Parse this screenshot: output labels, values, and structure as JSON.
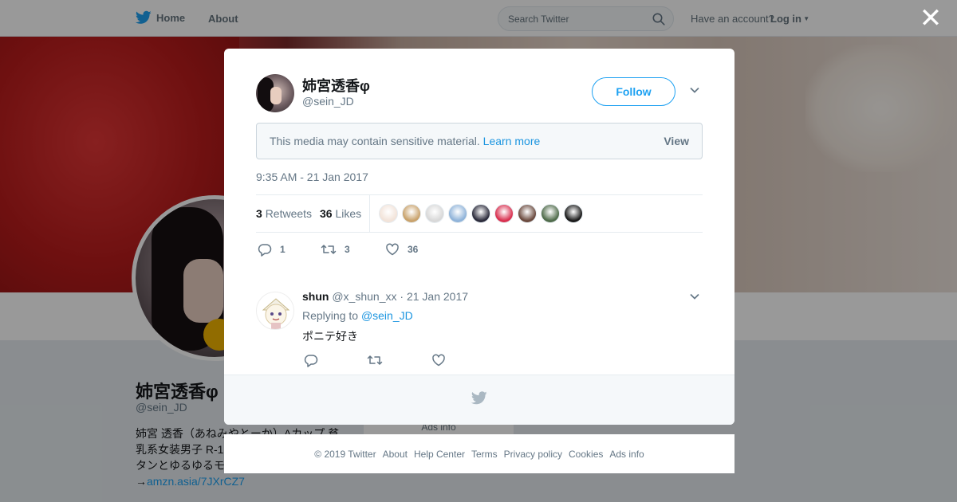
{
  "nav": {
    "home_label": "Home",
    "about_label": "About",
    "search_placeholder": "Search Twitter",
    "have_account": "Have an account?",
    "login_label": "Log in",
    "close_glyph": "✕"
  },
  "background_profile": {
    "name": "姉宮透香φ",
    "handle": "@sein_JD",
    "bio_line1": "姉宮 透香（あねみやとーか）Aカップ 貧",
    "bio_line2": "乳系女装男子 R-1",
    "bio_line3": "タンとゆるゆるモ",
    "bio_link_prefix": "→",
    "bio_link": "amzn.asia/7JXrCZ7",
    "ads_info": "Ads info"
  },
  "tweet": {
    "author_name": "姉宮透香φ",
    "author_handle": "@sein_JD",
    "follow_label": "Follow",
    "sensitive_text": "This media may contain sensitive material.",
    "learn_more": "Learn more",
    "view_label": "View",
    "timestamp": "9:35 AM - 21 Jan 2017",
    "retweet_count": "3",
    "retweet_label": "Retweets",
    "like_count": "36",
    "like_label": "Likes",
    "likers_colors": [
      "#f2e3d9",
      "#c9a26b",
      "#d8d8d8",
      "#8fb3d9",
      "#2b2b3b",
      "#d9304f",
      "#6b4a3e",
      "#4f6b4a",
      "#1a1a1a"
    ],
    "actions": {
      "replies": "1",
      "retweets": "3",
      "likes": "36"
    }
  },
  "reply": {
    "name": "shun",
    "handle": "@x_shun_xx",
    "separator": "·",
    "date": "21 Jan 2017",
    "replying_to_label": "Replying to",
    "replying_to_mention": "@sein_JD",
    "text": "ポニテ好き"
  },
  "footer": {
    "links": [
      "© 2019 Twitter",
      "About",
      "Help Center",
      "Terms",
      "Privacy policy",
      "Cookies",
      "Ads info"
    ]
  },
  "colors": {
    "accent": "#1da1f2",
    "link": "#1b95e0",
    "muted": "#657786"
  }
}
